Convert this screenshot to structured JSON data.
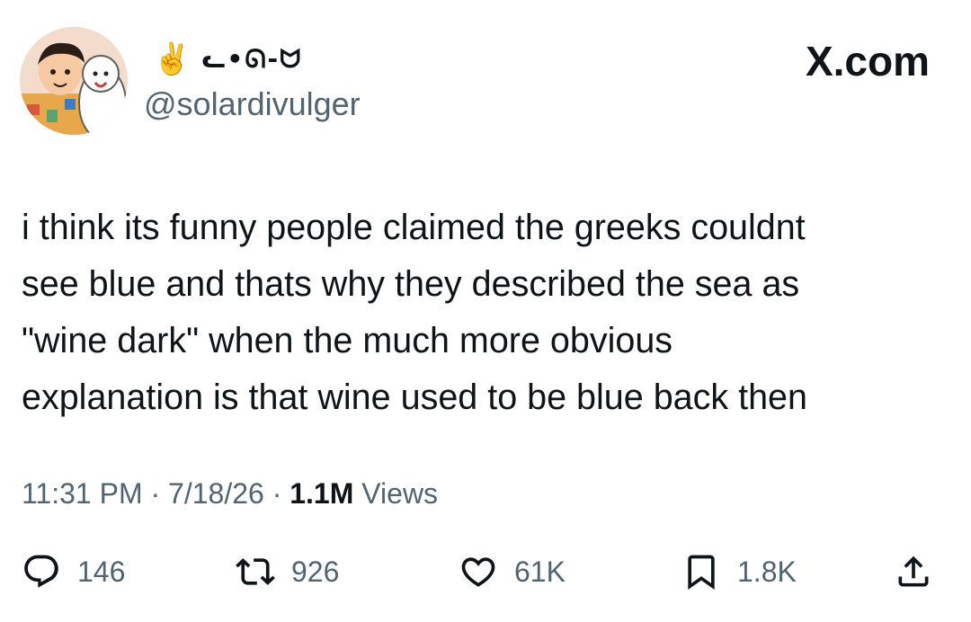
{
  "header": {
    "emoji": "✌️",
    "display_name": "ᓚ•ᘏ-ᗢ",
    "handle": "@solardivulger",
    "brand": "X.com"
  },
  "tweet": {
    "text": "i think its funny people claimed the greeks couldnt\nsee blue and thats why they described the sea as\n\"wine dark\" when the much more obvious\nexplanation is that wine used to be blue back then"
  },
  "meta": {
    "time": "11:31 PM",
    "separator": "·",
    "date": "7/18/26",
    "views_count": "1.1M",
    "views_label": "Views"
  },
  "actions": {
    "replies": "146",
    "reposts": "926",
    "likes": "61K",
    "bookmarks": "1.8K"
  },
  "icons": {
    "avatar": "avatar-illustration",
    "reply": "reply-icon",
    "repost": "repost-icon",
    "like": "heart-icon",
    "bookmark": "bookmark-icon",
    "share": "share-icon"
  },
  "colors": {
    "text": "#0f1419",
    "secondary": "#536471"
  }
}
